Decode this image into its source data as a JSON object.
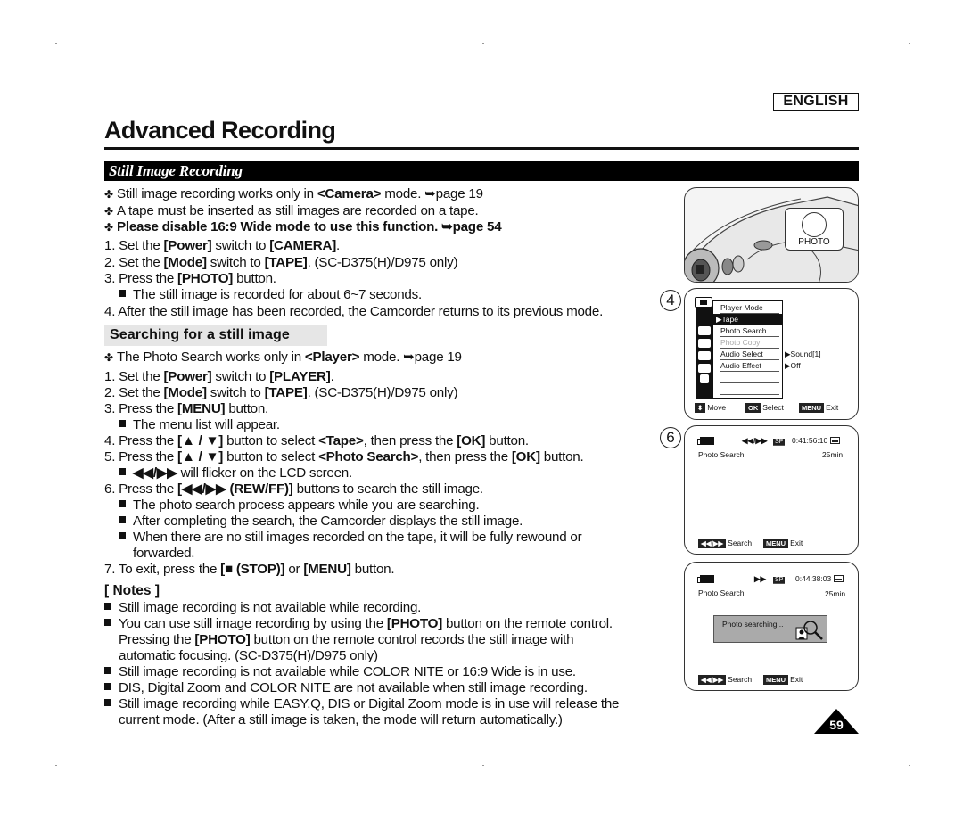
{
  "header": {
    "language_badge": "ENGLISH",
    "page_title": "Advanced Recording",
    "section_title": "Still Image Recording"
  },
  "intro": {
    "bullets": [
      {
        "pre": "Still image recording works only in ",
        "bold": "<Camera>",
        "post": " mode. ➥page 19"
      },
      {
        "pre": "A tape must be inserted as still images are recorded on a tape.",
        "bold": "",
        "post": ""
      },
      {
        "pre": "",
        "bold": "Please disable 16:9 Wide mode to use this function. ➥page 54",
        "post": ""
      }
    ],
    "steps": [
      {
        "n": "1. ",
        "a": "Set the ",
        "b1": "[Power]",
        "c": " switch to ",
        "b2": "[CAMERA]",
        "d": "."
      },
      {
        "n": "2. ",
        "a": "Set the ",
        "b1": "[Mode]",
        "c": " switch to ",
        "b2": "[TAPE]",
        "d": ". (SC-D375(H)/D975 only)"
      },
      {
        "n": "3. ",
        "a": "Press the ",
        "b1": "[PHOTO]",
        "c": " button.",
        "b2": "",
        "d": ""
      }
    ],
    "step3_note": "The still image is recorded for about 6~7 seconds.",
    "step4": "4. After the still image has been recorded, the Camcorder returns to its previous mode."
  },
  "search": {
    "heading": "Searching for a still image",
    "bullet": {
      "pre": "The Photo Search works only in ",
      "bold": "<Player>",
      "post": " mode. ➥page 19"
    },
    "steps": [
      {
        "n": "1. ",
        "a": "Set the ",
        "b1": "[Power]",
        "c": " switch to ",
        "b2": "[PLAYER]",
        "d": "."
      },
      {
        "n": "2. ",
        "a": "Set the ",
        "b1": "[Mode]",
        "c": " switch to ",
        "b2": "[TAPE]",
        "d": ". (SC-D375(H)/D975 only)"
      },
      {
        "n": "3. ",
        "a": "Press the ",
        "b1": "[MENU]",
        "c": " button.",
        "b2": "",
        "d": ""
      },
      {
        "n": "4. ",
        "a": "Press the ",
        "b1": "[▲ / ▼]",
        "c": " button to select ",
        "b2": "<Tape>",
        "d": ", then press the ",
        "b3": "[OK]",
        "e": " button."
      },
      {
        "n": "5. ",
        "a": "Press the ",
        "b1": "[▲ / ▼]",
        "c": " button to select ",
        "b2": "<Photo Search>",
        "d": ", then press the ",
        "b3": "[OK]",
        "e": " button."
      },
      {
        "n": "6. ",
        "a": "Press the ",
        "b1": "[◀◀/▶▶ (REW/FF)]",
        "c": " buttons to search the still image.",
        "b2": "",
        "d": ""
      },
      {
        "n": "7. ",
        "a": "To exit, press the ",
        "b1": "[■ (STOP)]",
        "c": " or ",
        "b2": "[MENU]",
        "d": " button."
      }
    ],
    "step3_note": "The menu list will appear.",
    "step5_note": {
      "bold": "◀◀/▶▶",
      "post": " will flicker on the LCD screen."
    },
    "step6_notes": [
      "The photo search process appears while you are searching.",
      "After completing the search, the Camcorder displays the still image.",
      "When there are no still images recorded on the tape, it will be fully rewound or",
      "forwarded."
    ]
  },
  "notes": {
    "title": "[ Notes ]",
    "items": [
      {
        "lines": [
          {
            "pre": "Still image recording is not available while recording."
          }
        ]
      },
      {
        "lines": [
          {
            "pre": "You can use still image recording by using the ",
            "bold": "[PHOTO]",
            "post": " button on the remote control."
          },
          {
            "pre": "Pressing the ",
            "bold": "[PHOTO]",
            "post": " button on the remote control records the still image with"
          },
          {
            "pre": "automatic focusing. (SC-D375(H)/D975 only)"
          }
        ]
      },
      {
        "lines": [
          {
            "pre": "Still image recording is not available while COLOR NITE or 16:9 Wide is in use."
          }
        ]
      },
      {
        "lines": [
          {
            "pre": "DIS, Digital Zoom and COLOR NITE are not available when still image recording."
          }
        ]
      },
      {
        "lines": [
          {
            "pre": "Still image recording while EASY.Q, DIS or Digital Zoom mode is in use will release the"
          },
          {
            "pre": "current mode. (After a still image is taken, the mode will return automatically.)"
          }
        ]
      }
    ]
  },
  "illustrations": {
    "camera": {
      "button_label": "PHOTO"
    },
    "screen4": {
      "step": "4",
      "menu_title": "Player Mode",
      "items": [
        {
          "label": "▶Tape",
          "state": "selected"
        },
        {
          "label": "Photo Search",
          "state": "normal"
        },
        {
          "label": "Photo Copy",
          "state": "disabled"
        },
        {
          "label": "Audio Select",
          "state": "normal",
          "value": "▶Sound[1]"
        },
        {
          "label": "Audio Effect",
          "state": "normal",
          "value": "▶Off"
        }
      ],
      "footer": {
        "move_key": "⬍",
        "move": "Move",
        "ok_key": "OK",
        "select": "Select",
        "menu_key": "MENU",
        "exit": "Exit"
      }
    },
    "screen6": {
      "step": "6",
      "transport": "◀◀/▶▶",
      "sp": "SP",
      "timecode": "0:41:56:10",
      "mode": "Photo Search",
      "remaining": "25min",
      "footer": {
        "search_key": "◀◀/▶▶",
        "search": "Search",
        "menu_key": "MENU",
        "exit": "Exit"
      }
    },
    "screen7": {
      "transport": "▶▶",
      "sp": "SP",
      "timecode": "0:44:38:03",
      "mode": "Photo Search",
      "remaining": "25min",
      "status": "Photo searching...",
      "footer": {
        "search_key": "◀◀/▶▶",
        "search": "Search",
        "menu_key": "MENU",
        "exit": "Exit"
      }
    }
  },
  "page_number": "59"
}
